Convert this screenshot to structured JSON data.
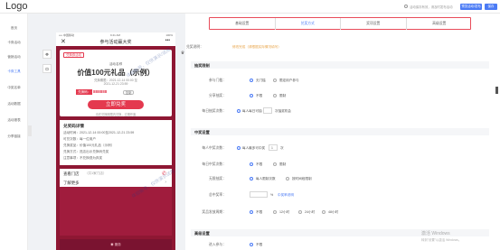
{
  "header": {
    "logo": "Logo",
    "tip": "活动保存有效，请及时发布活动",
    "preview_label": "预览活动/发布",
    "save_label": "保存"
  },
  "nav": {
    "items": [
      {
        "label": "首页"
      },
      {
        "label": "卡券活动"
      },
      {
        "label": "营销活动"
      },
      {
        "label": "卡券工具"
      },
      {
        "label": "中奖名单"
      },
      {
        "label": "活动数据"
      },
      {
        "label": "活动报表"
      },
      {
        "label": "分享链接"
      }
    ]
  },
  "canvas": {
    "tool_icons": [
      "gift-icon",
      "cake-icon",
      "chat-icon"
    ]
  },
  "phone": {
    "status_left": "•••• 中国移动",
    "status_time": "9:41 AM",
    "status_right": "100%",
    "close": "✕",
    "title": "参与活动赢大奖",
    "more": "•••",
    "card_tag": "兑换券活动",
    "card_sub": "活动名称",
    "card_title": "价值100元礼品（示例）",
    "time_start": "兑换期限：2021-12-14 00:00 至",
    "time_end": "2021-12-21 23:59",
    "code_label": "兑换码：",
    "code_value": "888888",
    "code_copy": "复制",
    "redeem_btn": "立即兑奖",
    "card_note": "请在兑换期限内兑换，过期作废",
    "details_title": "兑奖码详情",
    "detail_lines": [
      "活动时间：2021-12-14 00:00至2021-12-21 23:59",
      "可兑次数：每一位用户",
      "兑换奖品：价值100元礼品（示例）",
      "兑换方式：进店出示兑换码兑奖",
      "注意事项：不兑换视为弃奖"
    ],
    "shop_title": "查看门店",
    "shop_sub": "（共1家门店）",
    "more_title": "了解更多",
    "footer": "◉ 服务"
  },
  "watermarks": [
    "体验帐号，仅供演示/试用",
    "体验帐号，仅供演示试用"
  ],
  "tabs": [
    {
      "label": "基础设置"
    },
    {
      "label": "兑奖方式"
    },
    {
      "label": "奖项设置"
    },
    {
      "label": "高级设置"
    }
  ],
  "form": {
    "row1_label": "兑奖说明：",
    "row1_value": "修改完成（请根据实际情况填写）",
    "sec1": "抽奖限制",
    "participation_label": "参与门槛：",
    "participation_opts": [
      "无门槛",
      "限定用户参与"
    ],
    "share_label": "分享抽奖：",
    "share_opts": [
      "不限",
      "限制"
    ],
    "daily_label": "每日抽奖次数：",
    "daily_value": "每人每日可抽",
    "daily_unit": "次抽奖机会",
    "sec2": "中奖设置",
    "win_limit_label": "每人中奖次数：",
    "win_limit_value": "每人最多可中奖",
    "win_limit_count": "1",
    "win_limit_unit": "次",
    "total_limit_label": "每日中奖次数：",
    "total_limit_opts": [
      "不限",
      "限制"
    ],
    "unlimited_label": "无限抽奖：",
    "unlimited_opts": [
      "每人限制次数",
      "按时间段限制"
    ],
    "rate_label": "总中奖率：",
    "rate_value": "%",
    "rate_hint": "中奖率说明",
    "odds_label": "奖品发放周期：",
    "odds_opts": [
      "不限",
      "12小时",
      "24小时",
      "48小时"
    ],
    "sec3": "高级设置",
    "adv_label": "进入参与：",
    "adv_value": "不限"
  },
  "system": {
    "activate_title": "激活 Windows",
    "activate_sub": "转到\"设置\"以激活 Windows。"
  }
}
